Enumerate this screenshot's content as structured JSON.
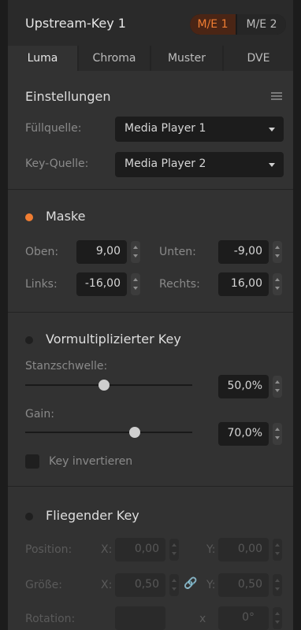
{
  "header": {
    "title": "Upstream-Key 1",
    "me1": "M/E 1",
    "me2": "M/E 2"
  },
  "tabs": [
    "Luma",
    "Chroma",
    "Muster",
    "DVE"
  ],
  "settings": {
    "title": "Einstellungen",
    "fill_label": "Füllquelle:",
    "fill_value": "Media Player 1",
    "key_label": "Key-Quelle:",
    "key_value": "Media Player 2"
  },
  "mask": {
    "title": "Maske",
    "enabled": true,
    "top_label": "Oben:",
    "top": "9,00",
    "bottom_label": "Unten:",
    "bottom": "-9,00",
    "left_label": "Links:",
    "left": "-16,00",
    "right_label": "Rechts:",
    "right": "16,00"
  },
  "premult": {
    "title": "Vormultiplizierter Key",
    "enabled": false,
    "clip_label": "Stanzschwelle:",
    "clip_value": "50,0%",
    "clip_level": 0.5,
    "gain_label": "Gain:",
    "gain_value": "70,0%",
    "gain_level": 0.7,
    "invert_label": "Key invertieren"
  },
  "flying": {
    "title": "Fliegender Key",
    "enabled": false,
    "position_label": "Position:",
    "x_label": "X:",
    "y_label": "Y:",
    "pos_x": "0,00",
    "pos_y": "0,00",
    "size_label": "Größe:",
    "size_x": "0,50",
    "size_y": "0,50",
    "rotation_label": "Rotation:",
    "rotation_x": "x",
    "rotation_value": "0°"
  },
  "colors": {
    "accent": "#f07d32",
    "panel": "#323232"
  }
}
